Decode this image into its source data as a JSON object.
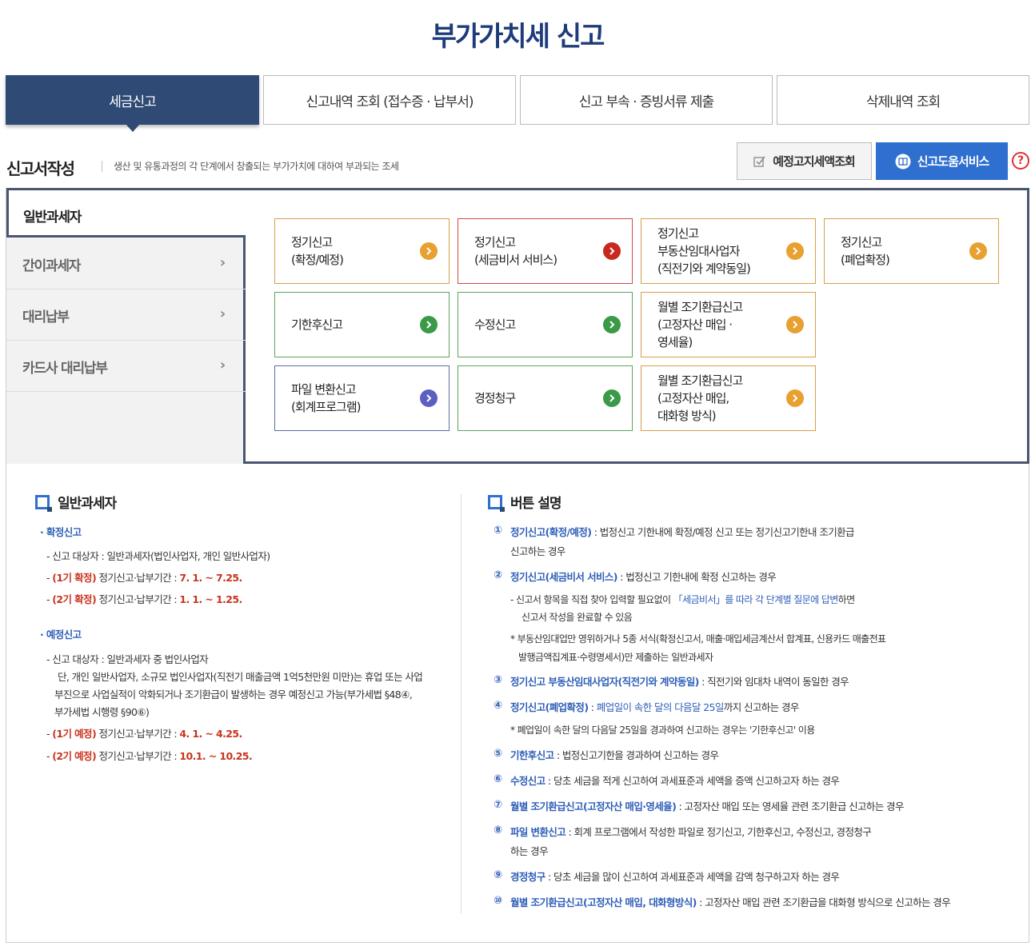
{
  "title": "부가가치세 신고",
  "tabs": [
    "세금신고",
    "신고내역 조회 (접수증 · 납부서)",
    "신고 부속 · 증빙서류 제출",
    "삭제내역 조회"
  ],
  "section": {
    "title": "신고서작성",
    "desc": "생산 및 유통과정의 각 단계에서 창출되는 부가가치에 대하여 부과되는 조세",
    "btn_estimate": "예정고지세액조회",
    "btn_help": "신고도움서비스",
    "help_q": "?"
  },
  "sidebar": {
    "active": "일반과세자",
    "items": [
      "간이과세자",
      "대리납부",
      "카드사 대리납부"
    ]
  },
  "cards": [
    {
      "line1": "정기신고",
      "line2": "(확정/예정)",
      "line3": "",
      "color": "#e8a030"
    },
    {
      "line1": "정기신고",
      "line2": "(세금비서 서비스)",
      "line3": "",
      "color": "#c8281d"
    },
    {
      "line1": "정기신고",
      "line2": "부동산임대사업자",
      "line3": "(직전기와 계약동일)",
      "color": "#e8a030"
    },
    {
      "line1": "정기신고",
      "line2": "(폐업확정)",
      "line3": "",
      "color": "#e8a030"
    },
    {
      "line1": "기한후신고",
      "line2": "",
      "line3": "",
      "color": "#3a9a48"
    },
    {
      "line1": "수정신고",
      "line2": "",
      "line3": "",
      "color": "#3a9a48"
    },
    {
      "line1": "월별 조기환급신고",
      "line2": "(고정자산 매입 ·",
      "line3": "영세율)",
      "color": "#e8a030"
    },
    {
      "line1": "파일 변환신고",
      "line2": "(회계프로그램)",
      "line3": "",
      "color": "#5a5fc0"
    },
    {
      "line1": "경정청구",
      "line2": "",
      "line3": "",
      "color": "#3a9a48"
    },
    {
      "line1": "월별 조기환급신고",
      "line2": "(고정자산 매입,",
      "line3": "대화형 방식)",
      "color": "#e8a030"
    }
  ],
  "left": {
    "heading": "일반과세자",
    "confirm_title": "확정신고",
    "confirm_target": "신고 대상자 : 일반과세자(법인사업자, 개인 일반사업자)",
    "confirm_1_label": "(1기 확정)",
    "confirm_1_mid": " 정기신고·납부기간 : ",
    "confirm_1_date": "7. 1. ~ 7.25.",
    "confirm_2_label": "(2기 확정)",
    "confirm_2_mid": " 정기신고·납부기간 : ",
    "confirm_2_date": "1. 1. ~ 1.25.",
    "pre_title": "예정신고",
    "pre_target": "신고 대상자 : 일반과세자 중 법인사업자",
    "pre_note1": "단, 개인 일반사업자, 소규모 법인사업자(직전기 매출금액 1억5천만원 미만)는 휴업 또는 사업",
    "pre_note2": "부진으로 사업실적이 악화되거나 조기환급이 발생하는 경우 예정신고 가능(부가세법 §48④,",
    "pre_note3": "부가세법 시행령 §90⑥)",
    "pre_1_label": "(1기 예정)",
    "pre_1_mid": " 정기신고·납부기간 : ",
    "pre_1_date": "4. 1. ~ 4.25.",
    "pre_2_label": "(2기 예정)",
    "pre_2_mid": " 정기신고·납부기간 : ",
    "pre_2_date": "10.1. ~ 10.25."
  },
  "right": {
    "heading": "버튼 설명",
    "n1": "①",
    "b1": "정기신고(확정/예정)",
    "t1": " : 법정신고 기한내에 확정/예정 신고 또는 정기신고기한내 조기환급",
    "t1b": "신고하는 경우",
    "n2": "②",
    "b2": "정기신고(세금비서 서비스)",
    "t2": " : 법정신고 기한내에 확정 신고하는 경우",
    "s2a_pre": "- 신고서 항목을 직접 찾아 입력할 필요없이 ",
    "s2a_blue": "「세금비서」를 따라 각 단계별 질문에 답변",
    "s2a_post": "하면",
    "s2b": "신고서 작성을 완료할 수 있음",
    "s2c": "* 부동산임대업만 영위하거나 5종 서식(확정신고서, 매출·매입세금계산서 합계표, 신용카드 매출전표",
    "s2d": "발행금액집계표·수령명세서)만 제출하는 일반과세자",
    "n3": "③",
    "b3": "정기신고 부동산임대사업자(직전기와 계약동일)",
    "t3": " : 직전기와 임대차 내역이 동일한 경우",
    "n4": "④",
    "b4": "정기신고(폐업확정)",
    "t4a": " : ",
    "t4blue": "폐업일이 속한 달의 다음달 25일",
    "t4b": "까지 신고하는 경우",
    "s4": "* 폐업일이 속한 달의 다음달 25일을 경과하여 신고하는 경우는 '기한후신고' 이용",
    "n5": "⑤",
    "b5": "기한후신고",
    "t5": " : 법정신고기한을 경과하여 신고하는 경우",
    "n6": "⑥",
    "b6": "수정신고",
    "t6": " : 당초 세금을 적게 신고하여 과세표준과 세액을 증액 신고하고자 하는 경우",
    "n7": "⑦",
    "b7": "월별 조기환급신고(고정자산 매입·영세율)",
    "t7": " : 고정자산 매입 또는 영세율 관련 조기환급 신고하는 경우",
    "n8": "⑧",
    "b8": "파일 변환신고",
    "t8": " : 회계 프로그램에서 작성한 파일로 정기신고, 기한후신고, 수정신고, 경정청구",
    "t8b": "하는 경우",
    "n9": "⑨",
    "b9": "경정청구",
    "t9": " : 당초 세금을 많이 신고하여 과세표준과 세액을 감액 청구하고자 하는 경우",
    "n10": "⑩",
    "b10": "월별 조기환급신고(고정자산 매입, 대화형방식)",
    "t10": " : 고정자산 매입 관련 조기환급을 대화형 방식으로 신고하는 경우"
  }
}
